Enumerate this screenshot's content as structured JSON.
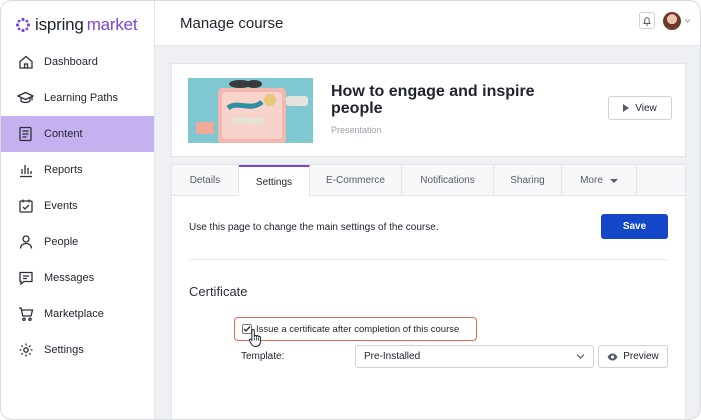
{
  "brand": {
    "name_part1": "ispring",
    "name_part2": "market",
    "accent": "#7a45d8"
  },
  "sidebar": {
    "items": [
      {
        "label": "Dashboard",
        "icon": "home-icon",
        "active": false
      },
      {
        "label": "Learning Paths",
        "icon": "graduation-cap-icon",
        "active": false
      },
      {
        "label": "Content",
        "icon": "document-icon",
        "active": true
      },
      {
        "label": "Reports",
        "icon": "bar-chart-icon",
        "active": false
      },
      {
        "label": "Events",
        "icon": "calendar-check-icon",
        "active": false
      },
      {
        "label": "People",
        "icon": "person-icon",
        "active": false
      },
      {
        "label": "Messages",
        "icon": "message-icon",
        "active": false
      },
      {
        "label": "Marketplace",
        "icon": "cart-icon",
        "active": false
      },
      {
        "label": "Settings",
        "icon": "gear-icon",
        "active": false
      }
    ],
    "active_color": "#c5b1f0"
  },
  "header": {
    "title": "Manage course",
    "icons": [
      "bell-icon",
      "avatar",
      "chevron-down-icon"
    ]
  },
  "course": {
    "title": "How to engage and inspire people",
    "type": "Presentation",
    "view_label": "View"
  },
  "tabs": [
    {
      "label": "Details",
      "active": false
    },
    {
      "label": "Settings",
      "active": true
    },
    {
      "label": "E-Commerce",
      "active": false
    },
    {
      "label": "Notifications",
      "active": false
    },
    {
      "label": "Sharing",
      "active": false
    },
    {
      "label": "More",
      "active": false,
      "dropdown": true
    }
  ],
  "settings": {
    "intro": "Use this page to change the main settings of the course.",
    "save_label": "Save",
    "save_color": "#1447c7",
    "section_title": "Certificate",
    "certificate_checkbox_label": "Issue a certificate after completion of this course",
    "certificate_checked": true,
    "highlight_color": "#e4674e",
    "template_label": "Template:",
    "template_value": "Pre-Installed",
    "preview_label": "Preview"
  }
}
